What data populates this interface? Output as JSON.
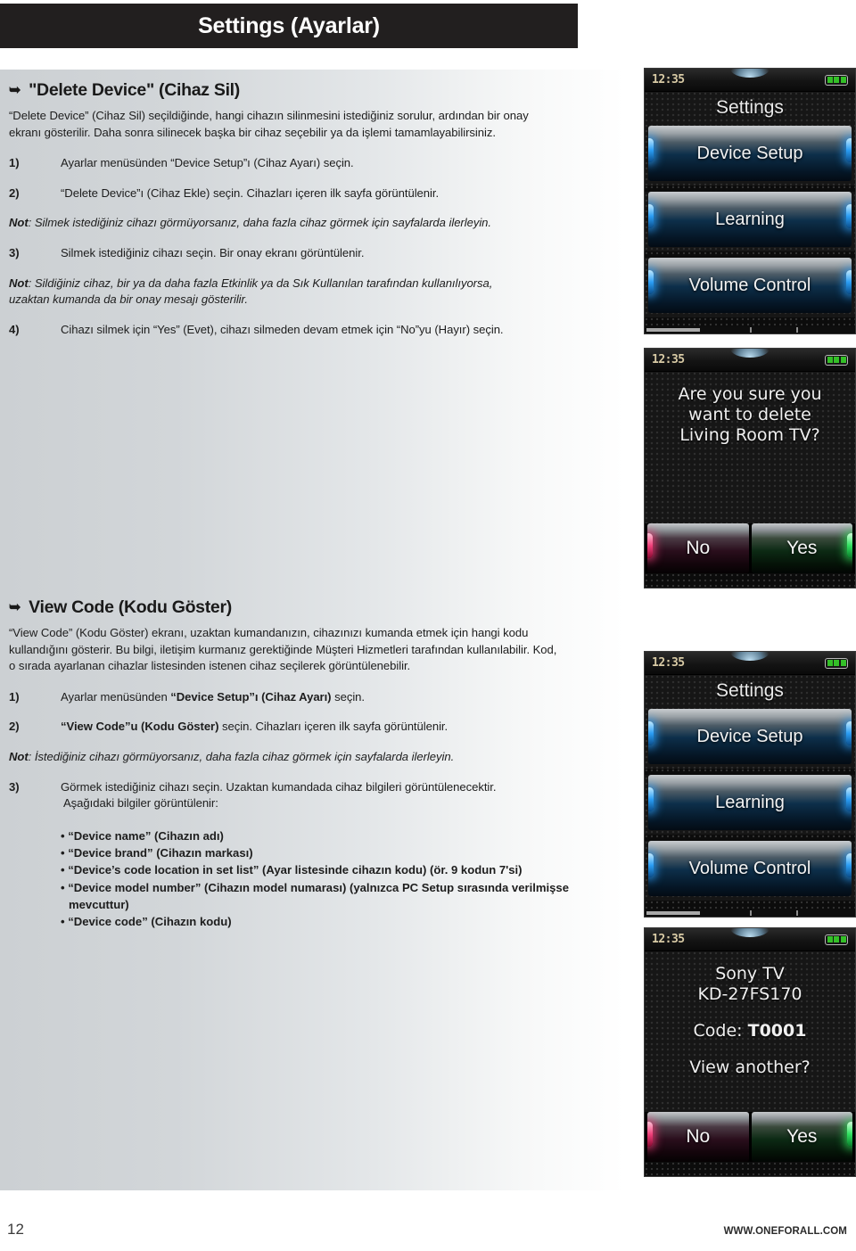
{
  "header": {
    "title": "Settings (Ayarlar)"
  },
  "sections": [
    {
      "heading": "\"Delete Device\" (Cihaz Sil)",
      "intro": "“Delete Device” (Cihaz Sil) seçildiğinde, hangi cihazın silinmesini istediğiniz sorulur, ardından bir onay ekranı gösterilir. Daha sonra silinecek başka bir cihaz seçebilir ya da işlemi tamamlayabilirsiniz.",
      "step1_num": "1)",
      "step1_text": "Ayarlar menüsünden “Device Setup”ı (Cihaz Ayarı) seçin.",
      "step2_num": "2)",
      "step2_text": "“Delete Device”ı (Cihaz Ekle) seçin. Cihazları içeren ilk sayfa görüntülenir.",
      "note1_label": "Not",
      "note1_text": ": Silmek istediğiniz cihazı görmüyorsanız, daha fazla cihaz görmek için sayfalarda ilerleyin.",
      "step3_num": "3)",
      "step3_text": "Silmek istediğiniz cihazı seçin. Bir onay ekranı görüntülenir.",
      "note2_label": "Not",
      "note2_text": ": Sildiğiniz cihaz, bir ya da daha fazla Etkinlik ya da Sık Kullanılan tarafından kullanılıyorsa, uzaktan kumanda da bir onay mesajı gösterilir.",
      "step4_num": "4)",
      "step4_text": "Cihazı silmek için “Yes” (Evet), cihazı silmeden devam etmek için “No”yu (Hayır) seçin."
    },
    {
      "heading": "View Code (Kodu Göster)",
      "intro": "“View Code” (Kodu Göster) ekranı, uzaktan kumandanızın, cihazınızı kumanda etmek için hangi kodu kullandığını gösterir. Bu bilgi, iletişim kurmanız gerektiğinde Müşteri Hizmetleri tarafından kullanılabilir. Kod, o sırada ayarlanan cihazlar listesinden istenen cihaz seçilerek görüntülenebilir.",
      "step1_num": "1)",
      "step1_text_a": "Ayarlar menüsünden ",
      "step1_text_b": "“Device Setup”ı (Cihaz Ayarı)",
      "step1_text_c": " seçin.",
      "step2_num": "2)",
      "step2_text_a": "“View Code”u (Kodu Göster)",
      "step2_text_b": " seçin. Cihazları içeren ilk sayfa görüntülenir.",
      "note1_label": "Not",
      "note1_text": ": İstediğiniz cihazı görmüyorsanız, daha fazla cihaz görmek için sayfalarda ilerleyin.",
      "step3_num": "3)",
      "step3_text": "Görmek istediğiniz cihazı seçin. Uzaktan kumandada cihaz bilgileri görüntülenecektir.",
      "step3_text2": "Aşağıdaki bilgiler görüntülenir:",
      "bullets": [
        "“Device name” (Cihazın adı)",
        " “Device brand” (Cihazın markası)",
        "“Device’s code location in set list” (Ayar listesinde cihazın kodu) (ör. 9 kodun 7'si)",
        "“Device model number” (Cihazın model numarası) (yalnızca PC Setup sırasında verilmişse mevcuttur)",
        "“Device code” (Cihazın kodu)"
      ]
    }
  ],
  "devices": [
    {
      "id": "settings-menu-1",
      "clock": "12:35",
      "screen_title": "Settings",
      "menu_items": [
        "Device Setup",
        "Learning",
        "Volume Control"
      ]
    },
    {
      "id": "delete-confirm",
      "clock": "12:35",
      "message_lines": [
        "Are you sure you",
        "want to delete",
        "Living Room TV?"
      ],
      "no_label": "No",
      "yes_label": "Yes"
    },
    {
      "id": "settings-menu-2",
      "clock": "12:35",
      "screen_title": "Settings",
      "menu_items": [
        "Device Setup",
        "Learning",
        "Volume Control"
      ]
    },
    {
      "id": "view-code-result",
      "clock": "12:35",
      "device_brand_type": "Sony TV",
      "device_model": "KD-27FS170",
      "code_label": "Code:",
      "code_value": "T0001",
      "prompt": "View another?",
      "no_label": "No",
      "yes_label": "Yes"
    }
  ],
  "footer": {
    "page_number": "12",
    "url": "WWW.ONEFORALL.COM"
  },
  "colors": {
    "header_bg": "#221f1f",
    "accent_blue": "#2a9df4",
    "accent_green": "#30e060",
    "accent_red": "#f0407a",
    "battery_green": "#34c028"
  }
}
